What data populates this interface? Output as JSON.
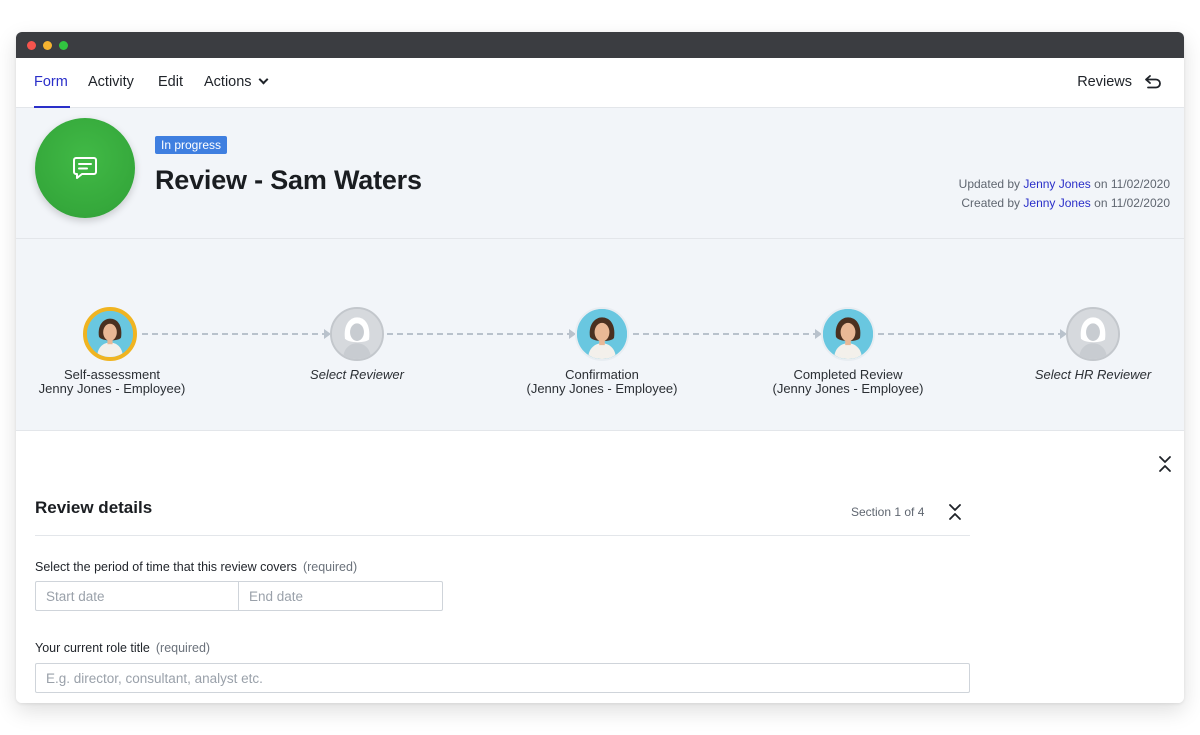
{
  "tabs": {
    "form": "Form",
    "activity": "Activity",
    "edit": "Edit",
    "actions": "Actions",
    "reviews_link": "Reviews"
  },
  "header": {
    "status_badge": "In progress",
    "title": "Review - Sam Waters",
    "updated_prefix": "Updated by",
    "updated_user": "Jenny Jones",
    "updated_on": "on 11/02/2020",
    "created_prefix": "Created by",
    "created_user": "Jenny Jones",
    "created_on": "on 11/02/2020"
  },
  "workflow": {
    "steps": [
      {
        "title": "Self-assessment",
        "subtitle": "Jenny Jones - Employee)",
        "assigned": true,
        "current": true
      },
      {
        "title": "Select Reviewer",
        "subtitle": "",
        "assigned": false,
        "current": false
      },
      {
        "title": "Confirmation",
        "subtitle": "(Jenny Jones - Employee)",
        "assigned": true,
        "current": false
      },
      {
        "title": "Completed Review",
        "subtitle": "(Jenny Jones - Employee)",
        "assigned": true,
        "current": false
      },
      {
        "title": "Select HR Reviewer",
        "subtitle": "",
        "assigned": false,
        "current": false
      }
    ]
  },
  "section": {
    "title": "Review details",
    "count": "Section 1 of 4",
    "period_label": "Select the period of time that this review covers",
    "period_required": "(required)",
    "start_placeholder": "Start date",
    "end_placeholder": "End date",
    "role_label": "Your current role title",
    "role_required": "(required)",
    "role_placeholder": "E.g. director, consultant, analyst etc."
  },
  "colors": {
    "accent": "#2a2fc9",
    "badge": "#3f7fe0",
    "form_icon": "#35a83b",
    "current_step_ring": "#f0b421"
  }
}
